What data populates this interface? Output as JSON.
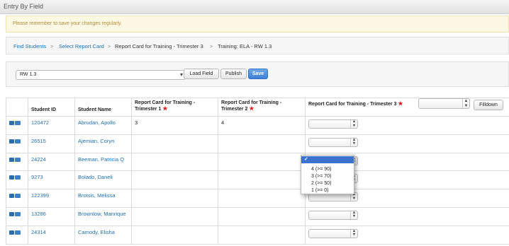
{
  "window": {
    "title": "Entry By Field"
  },
  "notice": {
    "text": "Please remember to save your changes regularly."
  },
  "breadcrumb": {
    "items": [
      "Find Students",
      "Report Card for Training - Trimester 3",
      "Training: ELA - RW 1.3"
    ],
    "link_2": "Select Report Card",
    "separator": ">"
  },
  "field_bar": {
    "field_select_value": "RW 1.3",
    "load_field_label": "Load Field",
    "publish_label": "Publish",
    "save_label": "Save"
  },
  "table": {
    "headers": {
      "student_id": "Student ID",
      "student_name": "Student Name",
      "t1": "Report Card for Training - Trimester 1",
      "t2": "Report Card for Training - Trimester 2",
      "t3": "Report Card for Training - Trimester 3",
      "required_mark": "★",
      "filldown_label": "Filldown"
    },
    "rows": [
      {
        "id": "120472",
        "name": "Abrudan, Apollo",
        "t1": "3",
        "t2": "4"
      },
      {
        "id": "26515",
        "name": "Ajemian, Coryn",
        "t1": "",
        "t2": ""
      },
      {
        "id": "24224",
        "name": "Beeman, Patricia Q",
        "t1": "",
        "t2": ""
      },
      {
        "id": "9273",
        "name": "Bolado, Daneli",
        "t1": "",
        "t2": ""
      },
      {
        "id": "122399",
        "name": "Brotsis, Melissa",
        "t1": "",
        "t2": ""
      },
      {
        "id": "13286",
        "name": "Brownlow, Manrique",
        "t1": "",
        "t2": ""
      },
      {
        "id": "24314",
        "name": "Camody, Elisha",
        "t1": "",
        "t2": ""
      }
    ]
  },
  "grade_dropdown": {
    "selected_mark": "✓",
    "options": [
      "4 (>= 90)",
      "3 (>= 70)",
      "2 (>= 50)",
      "1 (>= 0)"
    ]
  },
  "icons": {
    "row_icons": [
      "print-icon",
      "list-icon"
    ],
    "select_arrows": "up-down-arrows-icon"
  },
  "colors": {
    "link": "#1f6eb2",
    "primary_button": "#3c7fd6",
    "required_star": "#e02020",
    "notice_bg": "#fcf8e3"
  }
}
